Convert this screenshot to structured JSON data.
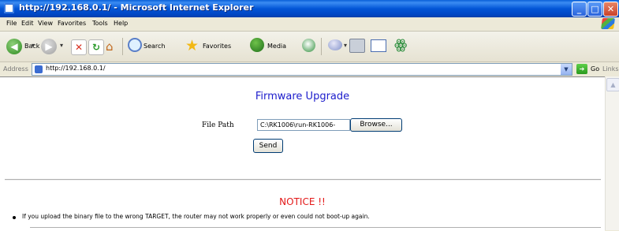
{
  "window": {
    "title": "http://192.168.0.1/ - Microsoft Internet Explorer",
    "controls": {
      "minimize": "_",
      "maximize": "□",
      "close": "✕"
    }
  },
  "menu": [
    "File",
    "Edit",
    "View",
    "Favorites",
    "Tools",
    "Help"
  ],
  "toolbar": {
    "back_label": "Back",
    "search_label": "Search",
    "favorites_label": "Favorites",
    "media_label": "Media"
  },
  "address": {
    "label": "Address",
    "url": "http://192.168.0.1/",
    "go_label": "Go",
    "links_label": "Links"
  },
  "page": {
    "title": "Firmware Upgrade",
    "file_path_label": "File Path",
    "file_path_value": "C:\\RK1006\\run-RK1006-",
    "browse_label": "Browse...",
    "send_label": "Send",
    "notice_title": "NOTICE !!",
    "notice_items": [
      "If you upload the binary file to the wrong TARGET, the router may not work properly or even could not boot-up again."
    ]
  }
}
